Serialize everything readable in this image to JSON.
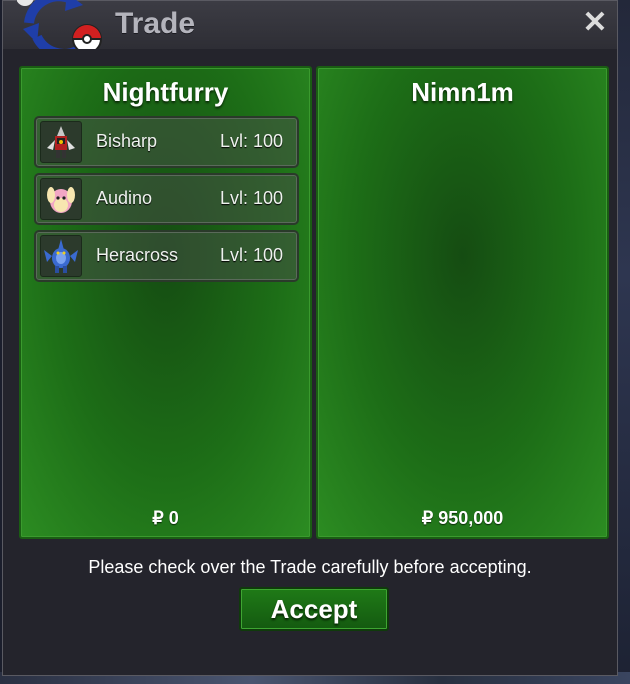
{
  "window": {
    "title": "Trade",
    "close_icon": "close-icon"
  },
  "panels": [
    {
      "owner": "Nightfurry",
      "pokemon": [
        {
          "name": "Bisharp",
          "level": "Lvl: 100",
          "icon": "bisharp-icon"
        },
        {
          "name": "Audino",
          "level": "Lvl: 100",
          "icon": "audino-icon"
        },
        {
          "name": "Heracross",
          "level": "Lvl: 100",
          "icon": "heracross-icon"
        }
      ],
      "money": "₽ 0"
    },
    {
      "owner": "Nimn1m",
      "pokemon": [],
      "money": "₽ 950,000"
    }
  ],
  "notice": "Please check over the Trade carefully before accepting.",
  "accept_label": "Accept",
  "colors": {
    "panel_green": "#1d6e17",
    "accept_green": "#1f7a17",
    "window_bg": "#24242c"
  }
}
